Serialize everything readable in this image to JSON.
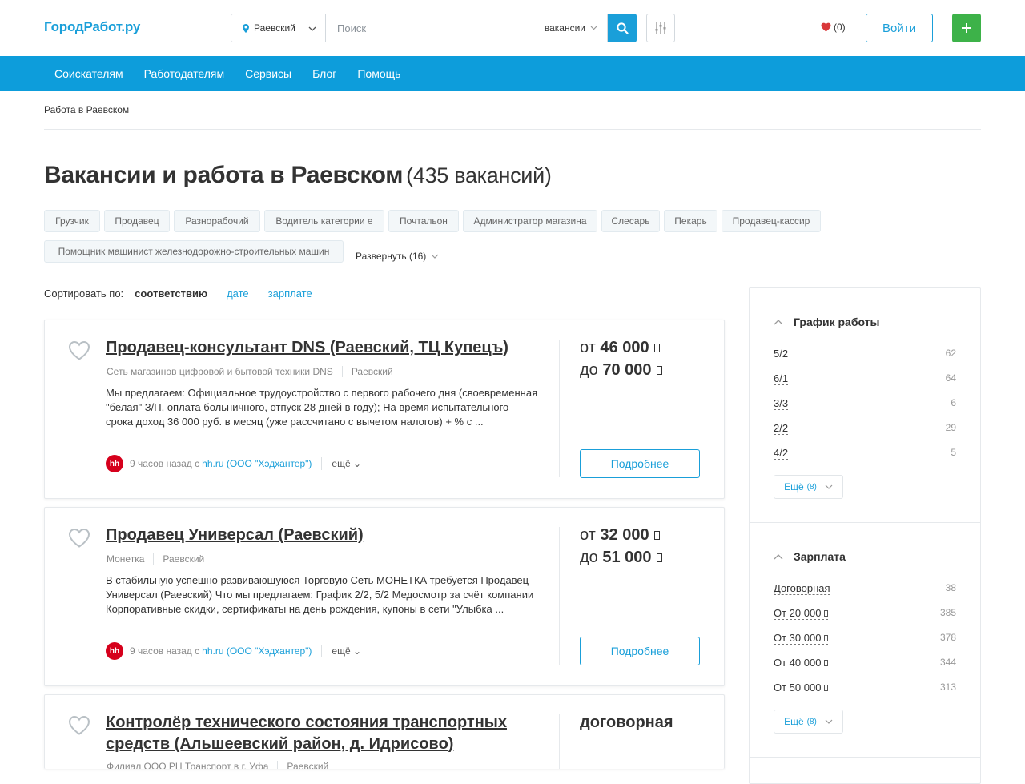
{
  "header": {
    "logo": "ГородРабот.ру",
    "city": "Раевский",
    "search_placeholder": "Поиск",
    "search_type": "вакансии",
    "favorites_count": "(0)",
    "login_label": "Войти",
    "add_label": "+"
  },
  "nav": {
    "items": [
      "Соискателям",
      "Работодателям",
      "Сервисы",
      "Блог",
      "Помощь"
    ]
  },
  "breadcrumb": "Работа в Раевском",
  "page": {
    "title": "Вакансии и работа в Раевском",
    "count": "(435 вакансий)"
  },
  "tags": [
    "Грузчик",
    "Продавец",
    "Разнорабочий",
    "Водитель категории е",
    "Почтальон",
    "Администратор магазина",
    "Слесарь",
    "Пекарь",
    "Продавец-кассир",
    "Помощник машинист железнодорожно-строительных машин"
  ],
  "expand_label": "Развернуть (16)",
  "sort": {
    "label": "Сортировать по:",
    "current": "соответствию",
    "options": [
      "дате",
      "зарплате"
    ]
  },
  "vacancies": [
    {
      "title": "Продавец-консультант DNS (Раевский, ТЦ Купецъ)",
      "company": "Сеть магазинов цифровой и бытовой техники DNS",
      "city": "Раевский",
      "description": "Мы предлагаем: Официальное трудоустройство с первого рабочего дня (своевременная \"белая\" З/П, оплата больничного, отпуск 28 дней в году); На время испытательного срока доход 36 000 руб. в месяц (уже рассчитано с вычетом налогов) + % с ...",
      "source_logo": "hh",
      "time": "9 часов назад с",
      "source": "hh.ru (ООО \"Хэдхантер\")",
      "more": "ещё",
      "salary_from_prefix": "от",
      "salary_from": "46 000",
      "salary_to_prefix": "до",
      "salary_to": "70 000",
      "detail_label": "Подробнее"
    },
    {
      "title": "Продавец Универсал (Раевский)",
      "company": "Монетка",
      "city": "Раевский",
      "description": "В стабильную успешно развивающуюся Торговую Сеть МОНЕТКА требуется Продавец Универсал (Раевский) Что мы предлагаем: График 2/2, 5/2 Медосмотр за счёт компании Корпоративные скидки, сертификаты на день рождения, купоны в сети \"Улыбка ...",
      "source_logo": "hh",
      "time": "9 часов назад с",
      "source": "hh.ru (ООО \"Хэдхантер\")",
      "more": "ещё",
      "salary_from_prefix": "от",
      "salary_from": "32 000",
      "salary_to_prefix": "до",
      "salary_to": "51 000",
      "detail_label": "Подробнее"
    },
    {
      "title": "Контролёр технического состояния транспортных средств (Альшеевский район, д. Идрисово)",
      "company": "Филиал ООО РН Транспорт в г. Уфа",
      "city": "Раевский",
      "salary": "договорная"
    }
  ],
  "sidebar": {
    "schedule": {
      "title": "График работы",
      "rows": [
        {
          "k": "5/2",
          "v": "62"
        },
        {
          "k": "6/1",
          "v": "64"
        },
        {
          "k": "3/3",
          "v": "6"
        },
        {
          "k": "2/2",
          "v": "29"
        },
        {
          "k": "4/2",
          "v": "5"
        }
      ],
      "more": "Ещё",
      "more_count": "(8)"
    },
    "salary": {
      "title": "Зарплата",
      "rows": [
        {
          "k": "Договорная",
          "v": "38"
        },
        {
          "k": "От 20 000",
          "v": "385"
        },
        {
          "k": "От 30 000",
          "v": "378"
        },
        {
          "k": "От 40 000",
          "v": "344"
        },
        {
          "k": "От 50 000",
          "v": "313"
        }
      ],
      "more": "Ещё",
      "more_count": "(8)"
    }
  },
  "colors": {
    "brand": "#1a9fd9",
    "nav": "#0d9ddb",
    "add": "#3db249",
    "hh": "#d6001c"
  }
}
